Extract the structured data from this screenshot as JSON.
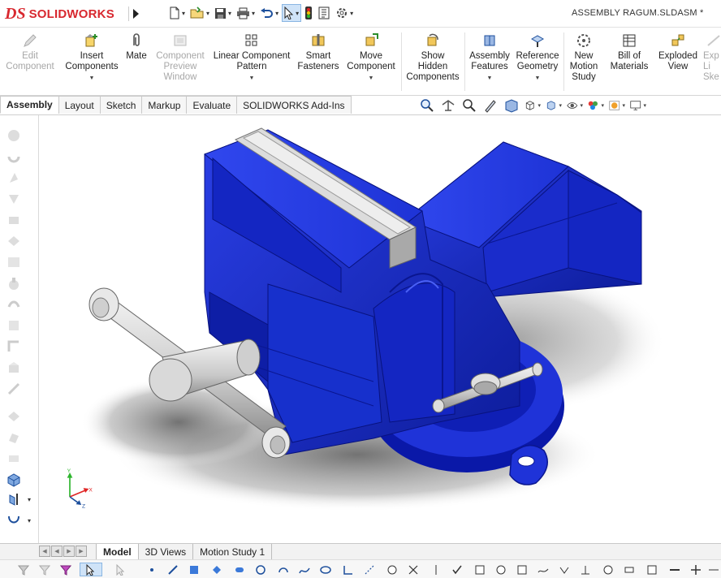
{
  "app": {
    "logo_mark": "DS",
    "logo_text": "SOLIDWORKS",
    "document_title": "ASSEMBLY RAGUM.SLDASM *"
  },
  "quick_access": [
    {
      "icon": "new-document-icon"
    },
    {
      "icon": "open-folder-icon"
    },
    {
      "icon": "save-icon"
    },
    {
      "icon": "print-icon"
    },
    {
      "icon": "undo-icon"
    },
    {
      "icon": "select-pointer-icon"
    },
    {
      "icon": "rebuild-traffic-light-icon"
    },
    {
      "icon": "file-properties-icon"
    },
    {
      "icon": "options-gear-icon"
    }
  ],
  "ribbon": {
    "buttons": [
      {
        "label": "Edit\nComponent",
        "enabled": false,
        "icon": "edit-component-icon"
      },
      {
        "label": "Insert\nComponents",
        "enabled": true,
        "icon": "insert-components-icon",
        "dropdown": true
      },
      {
        "label": "Mate",
        "enabled": true,
        "icon": "mate-paperclip-icon"
      },
      {
        "label": "Component\nPreview\nWindow",
        "enabled": false,
        "icon": "preview-window-icon"
      },
      {
        "label": "Linear Component\nPattern",
        "enabled": true,
        "icon": "linear-pattern-icon",
        "dropdown": true
      },
      {
        "label": "Smart\nFasteners",
        "enabled": true,
        "icon": "smart-fasteners-icon"
      },
      {
        "label": "Move\nComponent",
        "enabled": true,
        "icon": "move-component-icon",
        "dropdown": true
      },
      {
        "label": "Show\nHidden\nComponents",
        "enabled": true,
        "icon": "show-hidden-icon"
      },
      {
        "label": "Assembly\nFeatures",
        "enabled": true,
        "icon": "assembly-features-icon",
        "dropdown": true
      },
      {
        "label": "Reference\nGeometry",
        "enabled": true,
        "icon": "reference-geometry-icon",
        "dropdown": true
      },
      {
        "label": "New\nMotion\nStudy",
        "enabled": true,
        "icon": "motion-study-icon"
      },
      {
        "label": "Bill of\nMaterials",
        "enabled": true,
        "icon": "bill-of-materials-icon"
      },
      {
        "label": "Exploded\nView",
        "enabled": true,
        "icon": "exploded-view-icon"
      },
      {
        "label": "Exp\nLi\nSke",
        "enabled": false,
        "icon": "explode-line-sketch-icon"
      }
    ]
  },
  "command_tabs": [
    {
      "label": "Assembly",
      "active": true
    },
    {
      "label": "Layout"
    },
    {
      "label": "Sketch"
    },
    {
      "label": "Markup"
    },
    {
      "label": "Evaluate"
    },
    {
      "label": "SOLIDWORKS Add-Ins"
    }
  ],
  "view_tools": [
    "zoom-to-fit-icon",
    "zoom-to-area-icon",
    "previous-view-icon",
    "section-view-icon",
    "dynamic-annotation-icon",
    "3d-view-icon",
    "view-orientation-icon",
    "display-style-icon",
    "hide-show-items-icon",
    "edit-appearance-icon",
    "apply-scene-icon",
    "view-settings-icon",
    "monitor-icon"
  ],
  "bottom_tabs": [
    {
      "label": "Model",
      "active": true
    },
    {
      "label": "3D Views"
    },
    {
      "label": "Motion Study 1"
    }
  ],
  "triad": {
    "x_label": "X",
    "y_label": "Y",
    "z_label": "Z"
  },
  "colors": {
    "brand": "#d8282f",
    "vise_body": "#1a2fd0",
    "handle_steel": "#dcdcdc"
  }
}
